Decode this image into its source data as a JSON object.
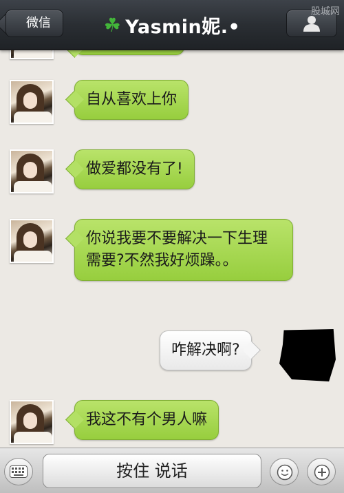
{
  "header": {
    "back_label": "微信",
    "title": "Yasmin妮.•",
    "watermark": "股城网"
  },
  "messages": [
    {
      "side": "left",
      "text": "自从喜欢上你"
    },
    {
      "side": "left",
      "text": "做爱都没有了!"
    },
    {
      "side": "left",
      "text": "你说我要不要解决一下生理需要?不然我好烦躁。。"
    },
    {
      "side": "right",
      "text": "咋解决啊?"
    },
    {
      "side": "left",
      "text": "我这不有个男人嘛"
    }
  ],
  "bottom": {
    "talk_label": "按住 说话"
  },
  "colors": {
    "incoming_bubble": "#a8d852",
    "outgoing_bubble": "#f2f2f2",
    "header_bg": "#2a2e33",
    "chat_bg": "#ece9e4"
  },
  "icons": [
    "back-chevron-icon",
    "clover-icon",
    "contact-profile-icon",
    "keyboard-icon",
    "emoji-icon",
    "add-more-icon"
  ]
}
